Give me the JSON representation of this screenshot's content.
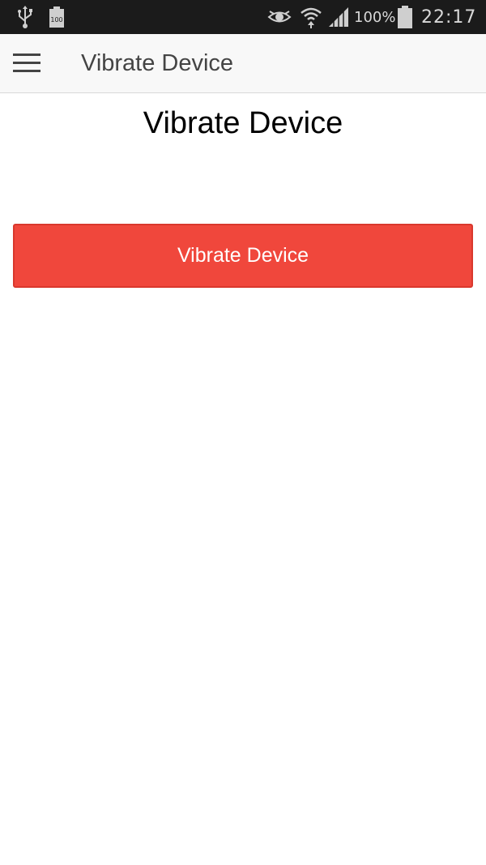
{
  "status_bar": {
    "icons": {
      "usb": "usb-icon",
      "battery_small": "battery-full-icon",
      "eye": "eye-icon",
      "wifi": "wifi-icon",
      "signal": "signal-icon",
      "battery": "battery-icon"
    },
    "battery_small_label": "100",
    "battery_percent": "100%",
    "time": "22:17"
  },
  "app_bar": {
    "menu_icon": "menu-icon",
    "title": "Vibrate Device"
  },
  "main": {
    "heading": "Vibrate Device",
    "vibrate_button_label": "Vibrate Device"
  },
  "colors": {
    "status_bar_bg": "#1b1b1b",
    "app_bar_bg": "#f8f8f8",
    "button_bg": "#f0473c",
    "button_text": "#ffffff"
  }
}
